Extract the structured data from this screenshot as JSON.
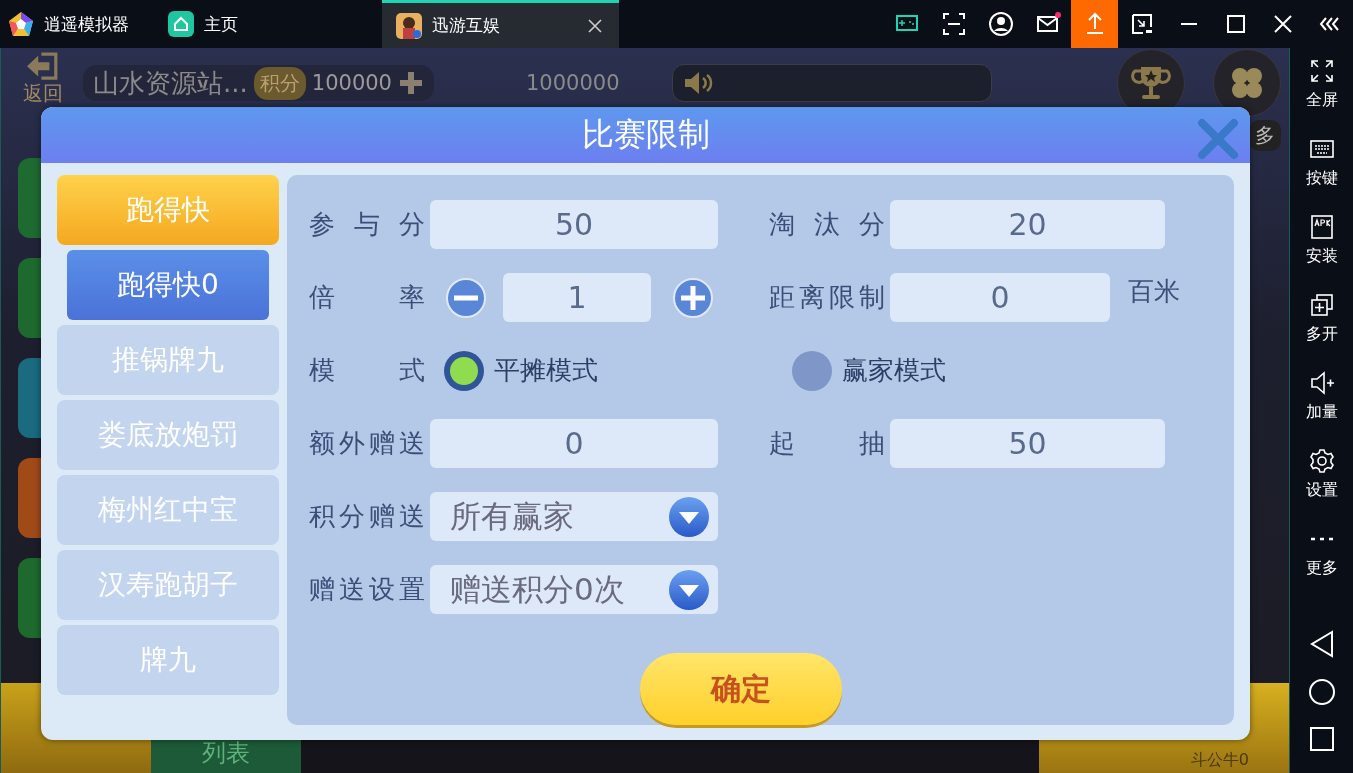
{
  "emulator": {
    "tabs": [
      {
        "kind": "app",
        "label": "逍遥模拟器",
        "selected": false
      },
      {
        "kind": "home",
        "label": "主页",
        "selected": false
      },
      {
        "kind": "game",
        "label": "迅游互娱",
        "selected": true
      }
    ],
    "sidebar": [
      {
        "kind": "fullscreen",
        "label": "全屏"
      },
      {
        "kind": "keyboard",
        "label": "按键"
      },
      {
        "kind": "apk",
        "label": "安装"
      },
      {
        "kind": "multi",
        "label": "多开"
      },
      {
        "kind": "volume",
        "label": "加量"
      },
      {
        "kind": "settings",
        "label": "设置"
      },
      {
        "kind": "more",
        "label": "更多"
      }
    ]
  },
  "game": {
    "back_label": "返回",
    "room_name": "山水资源站...",
    "points_label": "积分",
    "points": "100000",
    "coins": "1000000",
    "more_label": "多",
    "list_label": "列表",
    "start_sub": "斗公牛0"
  },
  "dialog": {
    "title": "比赛限制",
    "menu": [
      {
        "label": "跑得快",
        "selected": true,
        "children": [
          {
            "label": "跑得快0",
            "selected": true
          }
        ]
      },
      {
        "label": "推锅牌九",
        "selected": false
      },
      {
        "label": "娄底放炮罚",
        "selected": false
      },
      {
        "label": "梅州红中宝",
        "selected": false
      },
      {
        "label": "汉寿跑胡子",
        "selected": false
      },
      {
        "label": "牌九",
        "selected": false
      }
    ],
    "rows": [
      [
        {
          "kind": "input",
          "label": "参与分",
          "value": "50"
        },
        {
          "kind": "input",
          "label": "淘汰分",
          "value": "20"
        }
      ],
      [
        {
          "kind": "stepper",
          "label": "倍率",
          "value": "1"
        },
        {
          "kind": "input",
          "label": "距离限制",
          "value": "0",
          "unit": "百米"
        }
      ],
      [
        {
          "kind": "radio",
          "label": "模式",
          "option": "平摊模式",
          "selected": true
        },
        {
          "kind": "radio",
          "option": "赢家模式",
          "selected": false
        }
      ],
      [
        {
          "kind": "input",
          "label": "额外赠送",
          "value": "0"
        },
        {
          "kind": "input",
          "label": "起抽",
          "value": "50"
        }
      ],
      [
        {
          "kind": "dropdown",
          "label": "积分赠送",
          "value": "所有赢家"
        }
      ],
      [
        {
          "kind": "dropdown",
          "label": "赠送设置",
          "value": "赠送积分0次"
        }
      ]
    ],
    "confirm": "确定"
  }
}
